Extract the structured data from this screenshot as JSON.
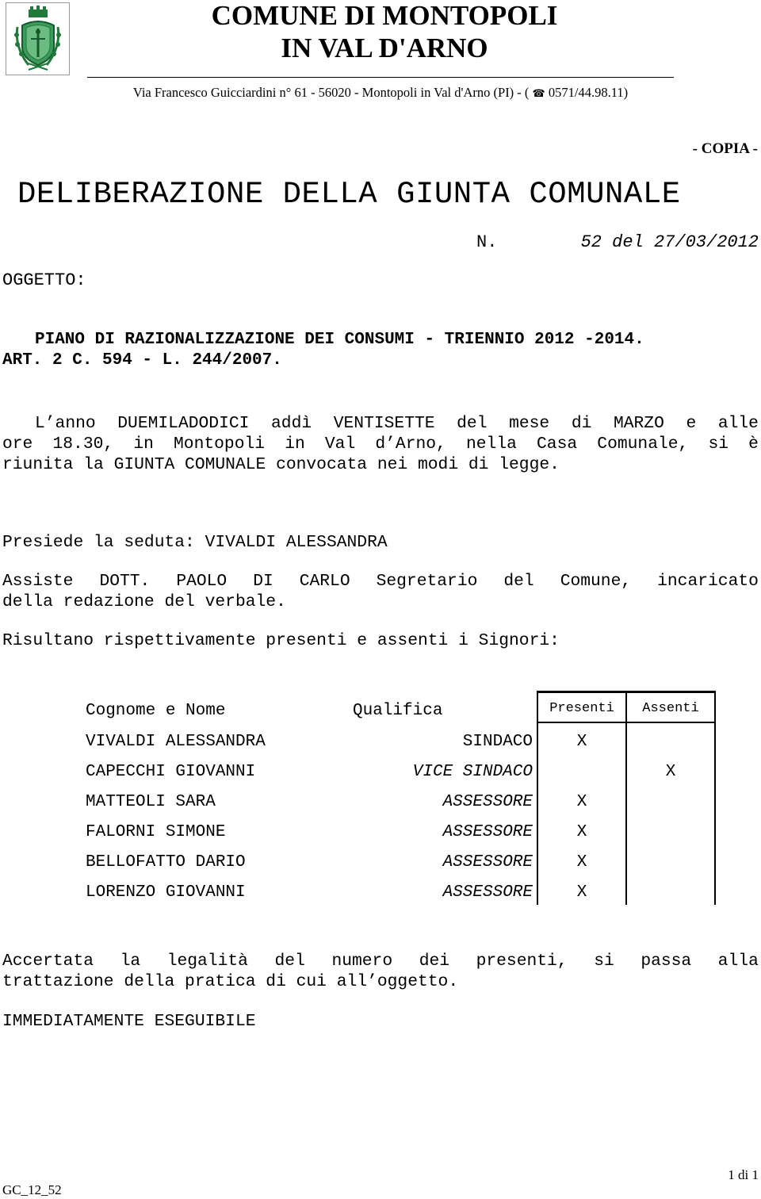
{
  "header": {
    "emblem": "municipal-coat-of-arms",
    "title_line1": "COMUNE DI MONTOPOLI",
    "title_line2": "IN VAL D'ARNO",
    "address_prefix": "Via Francesco Guicciardini n° 61 - 56020 - Montopoli in Val d'Arno (PI) - (",
    "phone_icon": "☎",
    "phone": "0571/44.98.11)",
    "copy_label": "- COPIA -"
  },
  "document": {
    "type_title": "DELIBERAZIONE DELLA GIUNTA COMUNALE",
    "number_label": "N.",
    "number_value": "52 del 27/03/2012",
    "subject_label": "OGGETTO:",
    "subject_line1": "PIANO DI RAZIONALIZZAZIONE DEI CONSUMI - TRIENNIO 2012 -2014.",
    "subject_line2": "ART. 2 C. 594 - L. 244/2007."
  },
  "body": {
    "intro_line1_words": [
      "L’anno",
      "DUEMILADODICI",
      "addì",
      "VENTISETTE",
      "del",
      "mese",
      "di",
      "MARZO",
      "e",
      "alle"
    ],
    "intro_line2_words": [
      "ore",
      "18.30,",
      "in",
      "Montopoli",
      "in",
      "Val",
      "d’Arno,",
      "nella",
      "Casa",
      "Comunale,",
      "si",
      "è"
    ],
    "intro_line3": "riunita la GIUNTA COMUNALE convocata nei modi di legge.",
    "presides": "Presiede la seduta: VIVALDI ALESSANDRA",
    "assists_line1_words": [
      "Assiste",
      "DOTT.",
      "PAOLO",
      "DI",
      "CARLO",
      "Segretario",
      "del",
      "Comune,",
      "incaricato"
    ],
    "assists_line2": "della redazione del verbale.",
    "attendance_intro": "Risultano rispettivamente presenti e assenti i Signori:",
    "legality_line1_words": [
      "Accertata",
      "la",
      "legalità",
      "del",
      "numero",
      "dei",
      "presenti,",
      "si",
      "passa",
      "alla"
    ],
    "legality_line2": "trattazione della pratica di cui all’oggetto.",
    "immediate": "IMMEDIATAMENTE ESEGUIBILE"
  },
  "attendance": {
    "headers": {
      "name": "Cognome e Nome",
      "role": "Qualifica",
      "present": "Presenti",
      "absent": "Assenti"
    },
    "rows": [
      {
        "name": "VIVALDI ALESSANDRA",
        "role": "SINDACO",
        "role_italic": false,
        "present": "X",
        "absent": ""
      },
      {
        "name": "CAPECCHI GIOVANNI",
        "role": "VICE SINDACO",
        "role_italic": true,
        "present": "",
        "absent": "X"
      },
      {
        "name": "MATTEOLI SARA",
        "role": "ASSESSORE",
        "role_italic": true,
        "present": "X",
        "absent": ""
      },
      {
        "name": "FALORNI SIMONE",
        "role": "ASSESSORE",
        "role_italic": true,
        "present": "X",
        "absent": ""
      },
      {
        "name": "BELLOFATTO DARIO",
        "role": "ASSESSORE",
        "role_italic": true,
        "present": "X",
        "absent": ""
      },
      {
        "name": "LORENZO GIOVANNI",
        "role": "ASSESSORE",
        "role_italic": true,
        "present": "X",
        "absent": ""
      }
    ]
  },
  "footer": {
    "page": "1 di 1",
    "code": "GC_12_52"
  }
}
